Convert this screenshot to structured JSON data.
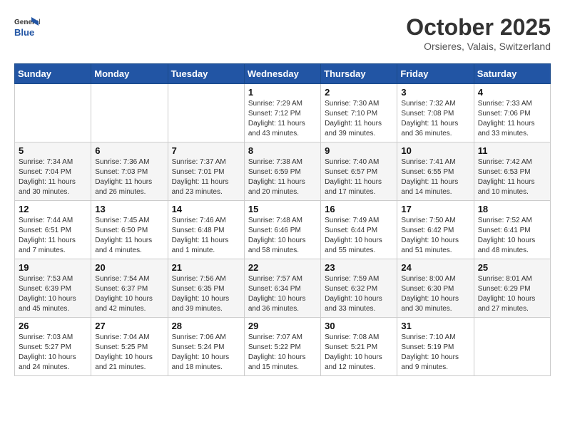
{
  "header": {
    "logo_line1": "General",
    "logo_line2": "Blue",
    "month": "October 2025",
    "location": "Orsieres, Valais, Switzerland"
  },
  "weekdays": [
    "Sunday",
    "Monday",
    "Tuesday",
    "Wednesday",
    "Thursday",
    "Friday",
    "Saturday"
  ],
  "weeks": [
    [
      {
        "day": "",
        "info": ""
      },
      {
        "day": "",
        "info": ""
      },
      {
        "day": "",
        "info": ""
      },
      {
        "day": "1",
        "info": "Sunrise: 7:29 AM\nSunset: 7:12 PM\nDaylight: 11 hours and 43 minutes."
      },
      {
        "day": "2",
        "info": "Sunrise: 7:30 AM\nSunset: 7:10 PM\nDaylight: 11 hours and 39 minutes."
      },
      {
        "day": "3",
        "info": "Sunrise: 7:32 AM\nSunset: 7:08 PM\nDaylight: 11 hours and 36 minutes."
      },
      {
        "day": "4",
        "info": "Sunrise: 7:33 AM\nSunset: 7:06 PM\nDaylight: 11 hours and 33 minutes."
      }
    ],
    [
      {
        "day": "5",
        "info": "Sunrise: 7:34 AM\nSunset: 7:04 PM\nDaylight: 11 hours and 30 minutes."
      },
      {
        "day": "6",
        "info": "Sunrise: 7:36 AM\nSunset: 7:03 PM\nDaylight: 11 hours and 26 minutes."
      },
      {
        "day": "7",
        "info": "Sunrise: 7:37 AM\nSunset: 7:01 PM\nDaylight: 11 hours and 23 minutes."
      },
      {
        "day": "8",
        "info": "Sunrise: 7:38 AM\nSunset: 6:59 PM\nDaylight: 11 hours and 20 minutes."
      },
      {
        "day": "9",
        "info": "Sunrise: 7:40 AM\nSunset: 6:57 PM\nDaylight: 11 hours and 17 minutes."
      },
      {
        "day": "10",
        "info": "Sunrise: 7:41 AM\nSunset: 6:55 PM\nDaylight: 11 hours and 14 minutes."
      },
      {
        "day": "11",
        "info": "Sunrise: 7:42 AM\nSunset: 6:53 PM\nDaylight: 11 hours and 10 minutes."
      }
    ],
    [
      {
        "day": "12",
        "info": "Sunrise: 7:44 AM\nSunset: 6:51 PM\nDaylight: 11 hours and 7 minutes."
      },
      {
        "day": "13",
        "info": "Sunrise: 7:45 AM\nSunset: 6:50 PM\nDaylight: 11 hours and 4 minutes."
      },
      {
        "day": "14",
        "info": "Sunrise: 7:46 AM\nSunset: 6:48 PM\nDaylight: 11 hours and 1 minute."
      },
      {
        "day": "15",
        "info": "Sunrise: 7:48 AM\nSunset: 6:46 PM\nDaylight: 10 hours and 58 minutes."
      },
      {
        "day": "16",
        "info": "Sunrise: 7:49 AM\nSunset: 6:44 PM\nDaylight: 10 hours and 55 minutes."
      },
      {
        "day": "17",
        "info": "Sunrise: 7:50 AM\nSunset: 6:42 PM\nDaylight: 10 hours and 51 minutes."
      },
      {
        "day": "18",
        "info": "Sunrise: 7:52 AM\nSunset: 6:41 PM\nDaylight: 10 hours and 48 minutes."
      }
    ],
    [
      {
        "day": "19",
        "info": "Sunrise: 7:53 AM\nSunset: 6:39 PM\nDaylight: 10 hours and 45 minutes."
      },
      {
        "day": "20",
        "info": "Sunrise: 7:54 AM\nSunset: 6:37 PM\nDaylight: 10 hours and 42 minutes."
      },
      {
        "day": "21",
        "info": "Sunrise: 7:56 AM\nSunset: 6:35 PM\nDaylight: 10 hours and 39 minutes."
      },
      {
        "day": "22",
        "info": "Sunrise: 7:57 AM\nSunset: 6:34 PM\nDaylight: 10 hours and 36 minutes."
      },
      {
        "day": "23",
        "info": "Sunrise: 7:59 AM\nSunset: 6:32 PM\nDaylight: 10 hours and 33 minutes."
      },
      {
        "day": "24",
        "info": "Sunrise: 8:00 AM\nSunset: 6:30 PM\nDaylight: 10 hours and 30 minutes."
      },
      {
        "day": "25",
        "info": "Sunrise: 8:01 AM\nSunset: 6:29 PM\nDaylight: 10 hours and 27 minutes."
      }
    ],
    [
      {
        "day": "26",
        "info": "Sunrise: 7:03 AM\nSunset: 5:27 PM\nDaylight: 10 hours and 24 minutes."
      },
      {
        "day": "27",
        "info": "Sunrise: 7:04 AM\nSunset: 5:25 PM\nDaylight: 10 hours and 21 minutes."
      },
      {
        "day": "28",
        "info": "Sunrise: 7:06 AM\nSunset: 5:24 PM\nDaylight: 10 hours and 18 minutes."
      },
      {
        "day": "29",
        "info": "Sunrise: 7:07 AM\nSunset: 5:22 PM\nDaylight: 10 hours and 15 minutes."
      },
      {
        "day": "30",
        "info": "Sunrise: 7:08 AM\nSunset: 5:21 PM\nDaylight: 10 hours and 12 minutes."
      },
      {
        "day": "31",
        "info": "Sunrise: 7:10 AM\nSunset: 5:19 PM\nDaylight: 10 hours and 9 minutes."
      },
      {
        "day": "",
        "info": ""
      }
    ]
  ]
}
